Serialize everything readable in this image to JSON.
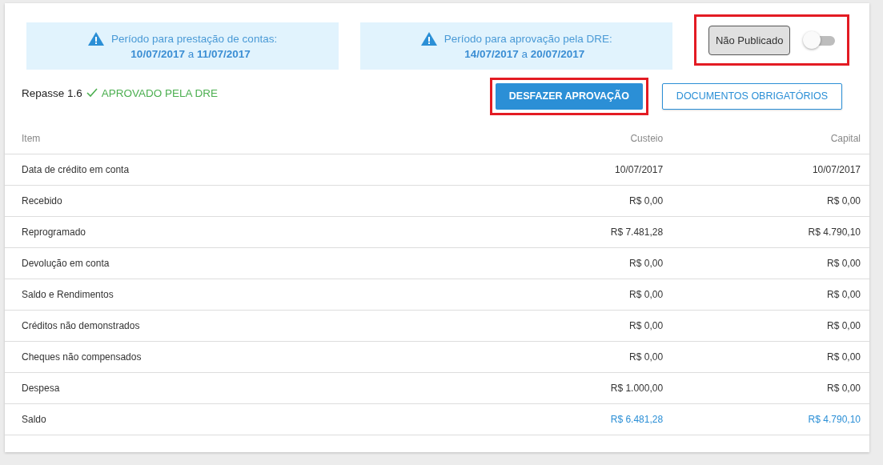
{
  "notices": [
    {
      "label": "Período para prestação de contas:",
      "start": "10/07/2017",
      "sep": "a",
      "end": "11/07/2017"
    },
    {
      "label": "Período para aprovação pela DRE:",
      "start": "14/07/2017",
      "sep": "a",
      "end": "20/07/2017"
    }
  ],
  "publish": {
    "status": "Não Publicado",
    "on": false,
    "highlighted": true
  },
  "repasse": {
    "title": "Repasse 1.6",
    "status": "APROVADO PELA DRE"
  },
  "buttons": [
    {
      "label": "DESFAZER APROVAÇÃO",
      "kind": "primary",
      "highlighted": true
    },
    {
      "label": "DOCUMENTOS OBRIGATÓRIOS",
      "kind": "outline",
      "highlighted": false
    }
  ],
  "table": {
    "columns": [
      "Item",
      "Custeio",
      "Capital"
    ],
    "rows": [
      {
        "kind": "normal",
        "cells": [
          "Data de crédito em conta",
          "10/07/2017",
          "10/07/2017"
        ]
      },
      {
        "kind": "normal",
        "cells": [
          "Recebido",
          "R$ 0,00",
          "R$ 0,00"
        ]
      },
      {
        "kind": "normal",
        "cells": [
          "Reprogramado",
          "R$ 7.481,28",
          "R$ 4.790,10"
        ]
      },
      {
        "kind": "normal",
        "cells": [
          "Devolução em conta",
          "R$ 0,00",
          "R$ 0,00"
        ]
      },
      {
        "kind": "normal",
        "cells": [
          "Saldo e Rendimentos",
          "R$ 0,00",
          "R$ 0,00"
        ]
      },
      {
        "kind": "normal",
        "cells": [
          "Créditos não demonstrados",
          "R$ 0,00",
          "R$ 0,00"
        ]
      },
      {
        "kind": "normal",
        "cells": [
          "Cheques não compensados",
          "R$ 0,00",
          "R$ 0,00"
        ]
      },
      {
        "kind": "normal",
        "cells": [
          "Despesa",
          "R$ 1.000,00",
          "R$ 0,00"
        ]
      },
      {
        "kind": "total",
        "cells": [
          "Saldo",
          "R$ 6.481,28",
          "R$ 4.790,10"
        ]
      }
    ]
  }
}
